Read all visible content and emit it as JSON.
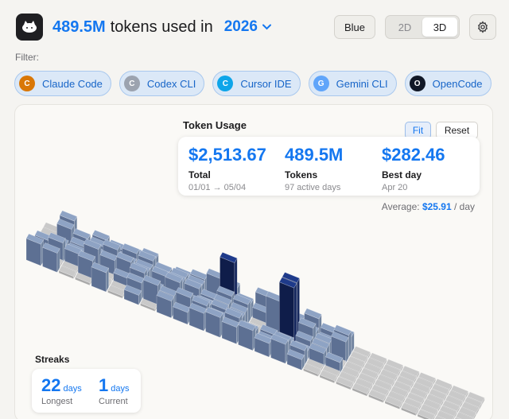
{
  "header": {
    "tokens_total": "489.5M",
    "headline_text": "tokens used in",
    "year": "2026",
    "theme_label": "Blue",
    "view_2d": "2D",
    "view_3d": "3D"
  },
  "filter": {
    "label": "Filter:",
    "chips": [
      {
        "initial": "C",
        "label": "Claude Code",
        "color": "#d97706"
      },
      {
        "initial": "C",
        "label": "Codex CLI",
        "color": "#9ca3af"
      },
      {
        "initial": "C",
        "label": "Cursor IDE",
        "color": "#0ea5e9"
      },
      {
        "initial": "G",
        "label": "Gemini CLI",
        "color": "#60a5fa"
      },
      {
        "initial": "O",
        "label": "OpenCode",
        "color": "#111827"
      }
    ]
  },
  "usage": {
    "title": "Token Usage",
    "fit_label": "Fit",
    "reset_label": "Reset",
    "total_value": "$2,513.67",
    "total_label": "Total",
    "total_sub": "01/01 → 05/04",
    "tokens_value": "489.5M",
    "tokens_label": "Tokens",
    "tokens_sub": "97 active days",
    "best_value": "$282.46",
    "best_label": "Best day",
    "best_sub": "Apr 20",
    "average_prefix": "Average:",
    "average_value": "$25.91",
    "average_suffix": "/ day"
  },
  "streaks": {
    "title": "Streaks",
    "longest_value": "22",
    "longest_unit": "days",
    "longest_label": "Longest",
    "current_value": "1",
    "current_unit": "days",
    "current_label": "Current"
  },
  "chart_colors": {
    "empty_top": "#c9c9c9",
    "empty_left": "#a9a9a9",
    "empty_right": "#b8b8b8",
    "bar_top": "#8ea3c4",
    "bar_left": "#5d7093",
    "bar_right": "#70839f",
    "peak_top": "#1e3a8a",
    "peak_left": "#0f1d4a",
    "peak_right": "#16285e"
  }
}
